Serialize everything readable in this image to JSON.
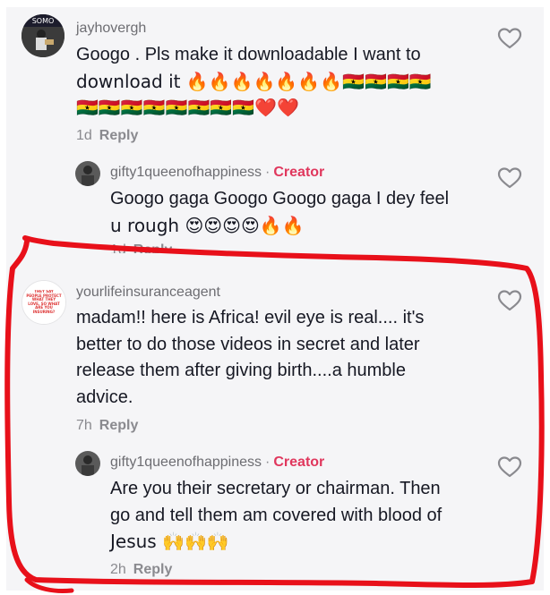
{
  "comments": [
    {
      "username": "jayhovergh",
      "avatar_text": "SOMO",
      "text_lines": [
        "Googo . Pls make it downloadable I want to",
        "download it 🔥🔥🔥🔥🔥🔥🔥🇬🇭🇬🇭🇬🇭🇬🇭",
        "🇬🇭🇬🇭🇬🇭🇬🇭🇬🇭🇬🇭🇬🇭🇬🇭❤️❤️"
      ],
      "time": "1d",
      "reply_label": "Reply"
    },
    {
      "username": "gifty1queenofhappiness",
      "badge": "Creator",
      "text_lines": [
        "Googo gaga Googo Googo gaga I dey feel",
        "u rough 😍😍😍😍🔥🔥"
      ],
      "time": "1d",
      "reply_label": "Reply"
    },
    {
      "username": "yourlifeinsuranceagent",
      "avatar_text": "THEY SAY PEOPLE PROTECT WHAT THEY LOVE. SO WHAT ARE YOU INSURING?",
      "text_lines": [
        "madam!! here is Africa! evil eye is real.... it's",
        "better to do those videos in secret and later",
        "release them after giving birth....a humble",
        "advice."
      ],
      "time": "7h",
      "reply_label": "Reply"
    },
    {
      "username": "gifty1queenofhappiness",
      "badge": "Creator",
      "text_lines": [
        "Are you their secretary or chairman. Then",
        "go and tell them am covered with blood of",
        "Jesus 🙌🙌🙌"
      ],
      "time": "2h",
      "reply_label": "Reply"
    }
  ],
  "colors": {
    "panel_bg": "#f5f5f7",
    "text": "#161823",
    "meta": "#8a8a8f",
    "creator_badge": "#e0375d",
    "annotation": "#e8101a"
  }
}
